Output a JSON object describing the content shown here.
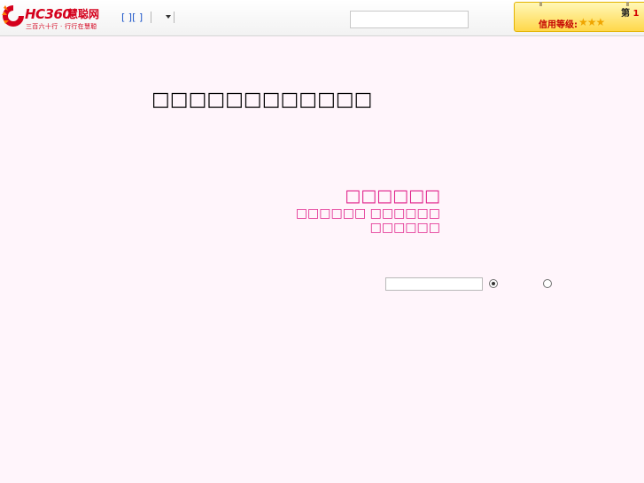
{
  "header": {
    "logo_text": "HC360",
    "logo_cn": "慧聪网",
    "logo_slogan": "三百六十行 · 行行在慧聪",
    "nav_links": [
      "[ ]",
      "[ ]"
    ],
    "search": {
      "select_value": "",
      "input_value": "",
      "input_placeholder": ""
    },
    "credit": {
      "label": "信用等级:",
      "stars": "★★★",
      "rank_prefix": "第",
      "rank_value": "1"
    }
  },
  "main": {
    "heading": "□□□□□□□□□□□□",
    "notice": {
      "title": "□□□□□□",
      "line1": "□□□□□□ □□□□□□",
      "line2": "□□□□□□"
    },
    "search": {
      "input_value": "",
      "options": [
        {
          "label": "",
          "checked": true
        },
        {
          "label": "",
          "checked": false
        }
      ]
    }
  },
  "colors": {
    "background": "#fff5fb",
    "brand_red": "#d4001c",
    "notice_pink": "#e0218a",
    "credit_gold": "#ffd84a"
  }
}
